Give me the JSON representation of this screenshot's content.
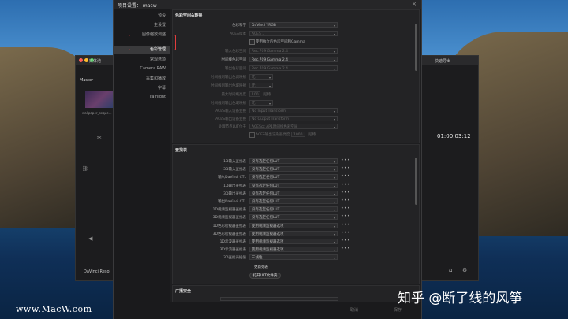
{
  "dialog": {
    "title": "项目设置：  macw",
    "close": "×",
    "sidebar": [
      "预设",
      "主设置",
      "图像缩放调整",
      "色彩管理",
      "常规选项",
      "Camera RAW",
      "采集和播放",
      "字幕",
      "Fairlight"
    ],
    "color_section": {
      "heading": "色彩空间&转换",
      "rows": [
        {
          "label": "色彩科学",
          "value": "DaVinci YRGB",
          "dim": false
        },
        {
          "label": "ACES版本",
          "value": "ACES 1",
          "dim": true
        },
        {
          "label": "",
          "value": "使用独立的色彩空间和Gamma",
          "dim": false,
          "checkbox": true
        },
        {
          "label": "输入色彩空间",
          "value": "Rec.709 Gamma 2.4",
          "dim": true
        },
        {
          "label": "时间线色彩空间",
          "value": "Rec.709 Gamma 2.4",
          "dim": false
        },
        {
          "label": "输出色彩空间",
          "value": "Rec.709 Gamma 2.4",
          "dim": true
        },
        {
          "label": "时间线到输出色调映射",
          "value": "无",
          "dim": true
        },
        {
          "label": "时间线到输出色域映射",
          "value": "无",
          "dim": true
        },
        {
          "label": "最大时间线亮度",
          "value": "100",
          "dim": true
        },
        {
          "label": "时间线到输出色域映射",
          "value": "无",
          "dim": true
        },
        {
          "label": "ACES输入设备变换",
          "value": "No Input Transform",
          "dim": true
        },
        {
          "label": "ACES输出设备变换",
          "value": "No Output Transform",
          "dim": true
        },
        {
          "label": "处理节点LUT位于",
          "value": "ACEScc AP1时间线色彩空间",
          "dim": true
        },
        {
          "label": "",
          "value": "ACES输出渲染器亮度",
          "dim": true
        }
      ],
      "nits_label": "尼特",
      "nits_value": "1000",
      "nits2_label": "尼特"
    },
    "lut_section": {
      "heading": "查找表",
      "rows": [
        {
          "label": "1D输入查找表",
          "value": "没有选定任何LUT",
          "more": "•••"
        },
        {
          "label": "3D输入查找表",
          "value": "没有选定任何LUT",
          "more": "•••"
        },
        {
          "label": "输入DaVinci CTL",
          "value": "没有选定任何LUT",
          "more": "•••"
        },
        {
          "label": "1D输出查找表",
          "value": "没有选定任何LUT",
          "more": "•••"
        },
        {
          "label": "3D输出查找表",
          "value": "没有选定任何LUT",
          "more": "•••"
        },
        {
          "label": "输出DaVinci CTL",
          "value": "没有选定任何LUT",
          "more": "•••"
        },
        {
          "label": "1D视频监视器查找表",
          "value": "没有选定任何LUT",
          "more": "•••"
        },
        {
          "label": "3D视频监视器查找表",
          "value": "没有选定任何LUT",
          "more": "•••"
        },
        {
          "label": "1D色彩检视器查找表",
          "value": "使用视频监视器选项",
          "more": "•••"
        },
        {
          "label": "3D色彩检视器查找表",
          "value": "使用视频监视器选项",
          "more": "•••"
        },
        {
          "label": "1D示波器查找表",
          "value": "使用视频监视器选项",
          "more": "•••"
        },
        {
          "label": "3D示波器查找表",
          "value": "使用视频监视器选项",
          "more": "•••"
        },
        {
          "label": "3D查找表插值",
          "value": "三线性",
          "more": ""
        }
      ],
      "refresh": "更新列表",
      "open_folder": "打开LUT文件夹"
    },
    "broadcast_heading": "广播安全",
    "footer": {
      "cancel": "取消",
      "save": "保存"
    }
  },
  "resolve": {
    "media_pool": "媒体池",
    "master": "Master",
    "clip_name": "wallpaper_seque...",
    "quick_export": "快速导出",
    "timecode": "01:00:03:12",
    "app_name": "DaVinci Resol"
  },
  "watermarks": {
    "left": "www.MacW.com",
    "right": "知乎 @断了线的风筝"
  }
}
